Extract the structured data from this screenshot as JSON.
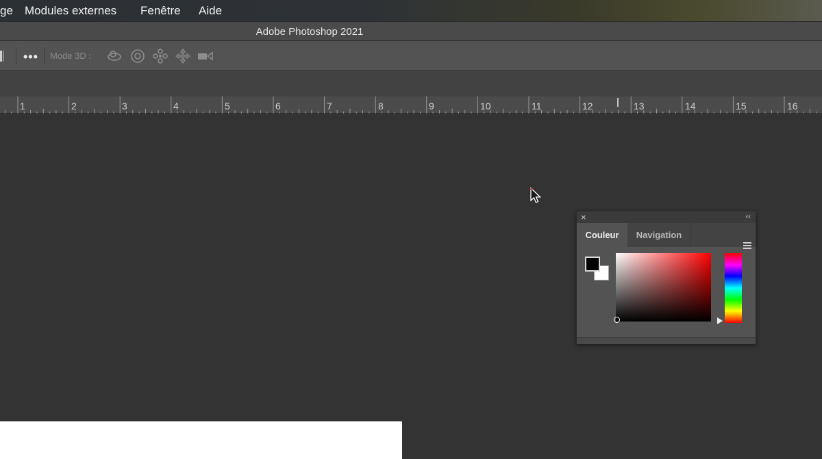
{
  "menubar": {
    "items": [
      {
        "label": "ge"
      },
      {
        "label": "Modules externes"
      },
      {
        "label": "Fenêtre"
      },
      {
        "label": "Aide"
      }
    ]
  },
  "titlebar": {
    "title": "Adobe Photoshop 2021"
  },
  "options_bar": {
    "more_label": "•••",
    "mode3d_label": "Mode 3D :",
    "icons": [
      "orbit-3d-icon",
      "roll-3d-icon",
      "pan-3d-icon",
      "slide-3d-icon",
      "scale-3d-icon"
    ]
  },
  "ruler": {
    "labels": [
      "1",
      "2",
      "3",
      "4",
      "5",
      "6",
      "7",
      "8",
      "9",
      "10",
      "11",
      "12",
      "13",
      "14",
      "15",
      "16"
    ]
  },
  "color_panel": {
    "close_glyph": "×",
    "collapse_glyph": "‹‹",
    "tabs": [
      {
        "label": "Couleur",
        "active": true
      },
      {
        "label": "Navigation",
        "active": false
      }
    ],
    "foreground_color": "#000000",
    "background_color": "#ffffff",
    "hue_color": "#ff0000"
  },
  "colors": {
    "app_background": "#323232",
    "options_bar": "#535353",
    "panel": "#535353"
  }
}
